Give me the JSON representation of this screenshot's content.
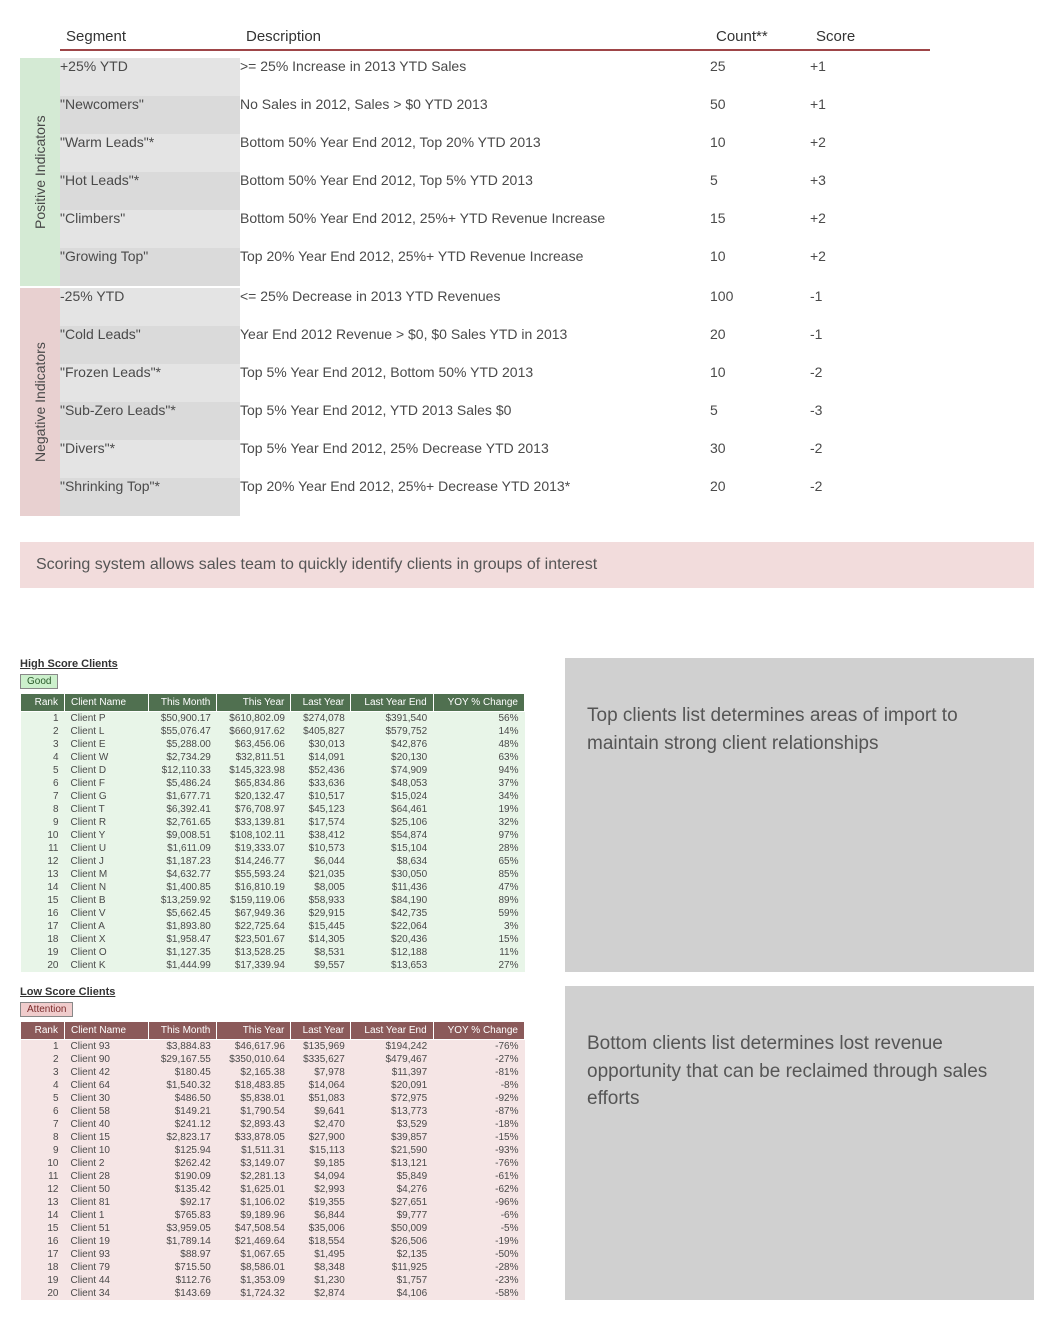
{
  "headers": {
    "segment": "Segment",
    "description": "Description",
    "count": "Count**",
    "score": "Score"
  },
  "side_labels": {
    "positive": "Positive Indicators",
    "negative": "Negative Indicators"
  },
  "positive_rows": [
    {
      "segment": "+25% YTD",
      "description": ">= 25% Increase in 2013 YTD Sales",
      "count": "25",
      "score": "+1"
    },
    {
      "segment": "\"Newcomers\"",
      "description": "No Sales in 2012, Sales > $0 YTD 2013",
      "count": "50",
      "score": "+1"
    },
    {
      "segment": "\"Warm Leads\"*",
      "description": "Bottom 50% Year End 2012, Top 20% YTD 2013",
      "count": "10",
      "score": "+2"
    },
    {
      "segment": "\"Hot Leads\"*",
      "description": "Bottom 50% Year End 2012, Top 5% YTD 2013",
      "count": "5",
      "score": "+3"
    },
    {
      "segment": "\"Climbers\"",
      "description": "Bottom 50% Year End 2012, 25%+ YTD Revenue Increase",
      "count": "15",
      "score": "+2"
    },
    {
      "segment": "\"Growing Top\"",
      "description": "Top 20% Year End 2012, 25%+ YTD Revenue Increase",
      "count": "10",
      "score": "+2"
    }
  ],
  "negative_rows": [
    {
      "segment": "-25% YTD",
      "description": "<= 25% Decrease in 2013 YTD Revenues",
      "count": "100",
      "score": "-1"
    },
    {
      "segment": "\"Cold Leads\"",
      "description": "Year End 2012 Revenue > $0, $0 Sales YTD in 2013",
      "count": "20",
      "score": "-1"
    },
    {
      "segment": "\"Frozen Leads\"*",
      "description": "Top 5% Year End 2012, Bottom 50% YTD 2013",
      "count": "10",
      "score": "-2"
    },
    {
      "segment": "\"Sub-Zero Leads\"*",
      "description": "Top 5% Year End 2012, YTD 2013 Sales $0",
      "count": "5",
      "score": "-3"
    },
    {
      "segment": "\"Divers\"*",
      "description": "Top 5% Year End 2012, 25% Decrease YTD 2013",
      "count": "30",
      "score": "-2"
    },
    {
      "segment": "\"Shrinking Top\"*",
      "description": "Top 20% Year End 2012, 25%+ Decrease YTD 2013*",
      "count": "20",
      "score": "-2"
    }
  ],
  "caption_main": "Scoring system allows sales team to quickly identify clients in groups of interest",
  "high_clients": {
    "title": "High Score Clients",
    "tag": "Good",
    "columns": [
      "Rank",
      "Client Name",
      "This Month",
      "This Year",
      "Last Year",
      "Last Year End",
      "YOY % Change"
    ],
    "rows": [
      [
        "1",
        "Client P",
        "$50,900.17",
        "$610,802.09",
        "$274,078",
        "$391,540",
        "56%"
      ],
      [
        "2",
        "Client L",
        "$55,076.47",
        "$660,917.62",
        "$405,827",
        "$579,752",
        "14%"
      ],
      [
        "3",
        "Client E",
        "$5,288.00",
        "$63,456.06",
        "$30,013",
        "$42,876",
        "48%"
      ],
      [
        "4",
        "Client W",
        "$2,734.29",
        "$32,811.51",
        "$14,091",
        "$20,130",
        "63%"
      ],
      [
        "5",
        "Client D",
        "$12,110.33",
        "$145,323.98",
        "$52,436",
        "$74,909",
        "94%"
      ],
      [
        "6",
        "Client F",
        "$5,486.24",
        "$65,834.86",
        "$33,636",
        "$48,053",
        "37%"
      ],
      [
        "7",
        "Client G",
        "$1,677.71",
        "$20,132.47",
        "$10,517",
        "$15,024",
        "34%"
      ],
      [
        "8",
        "Client T",
        "$6,392.41",
        "$76,708.97",
        "$45,123",
        "$64,461",
        "19%"
      ],
      [
        "9",
        "Client R",
        "$2,761.65",
        "$33,139.81",
        "$17,574",
        "$25,106",
        "32%"
      ],
      [
        "10",
        "Client Y",
        "$9,008.51",
        "$108,102.11",
        "$38,412",
        "$54,874",
        "97%"
      ],
      [
        "11",
        "Client U",
        "$1,611.09",
        "$19,333.07",
        "$10,573",
        "$15,104",
        "28%"
      ],
      [
        "12",
        "Client J",
        "$1,187.23",
        "$14,246.77",
        "$6,044",
        "$8,634",
        "65%"
      ],
      [
        "13",
        "Client M",
        "$4,632.77",
        "$55,593.24",
        "$21,035",
        "$30,050",
        "85%"
      ],
      [
        "14",
        "Client N",
        "$1,400.85",
        "$16,810.19",
        "$8,005",
        "$11,436",
        "47%"
      ],
      [
        "15",
        "Client B",
        "$13,259.92",
        "$159,119.06",
        "$58,933",
        "$84,190",
        "89%"
      ],
      [
        "16",
        "Client V",
        "$5,662.45",
        "$67,949.36",
        "$29,915",
        "$42,735",
        "59%"
      ],
      [
        "17",
        "Client A",
        "$1,893.80",
        "$22,725.64",
        "$15,445",
        "$22,064",
        "3%"
      ],
      [
        "18",
        "Client X",
        "$1,958.47",
        "$23,501.67",
        "$14,305",
        "$20,436",
        "15%"
      ],
      [
        "19",
        "Client O",
        "$1,127.35",
        "$13,528.25",
        "$8,531",
        "$12,188",
        "11%"
      ],
      [
        "20",
        "Client K",
        "$1,444.99",
        "$17,339.94",
        "$9,557",
        "$13,653",
        "27%"
      ]
    ],
    "caption": "Top clients list determines areas of import to maintain strong client relationships"
  },
  "low_clients": {
    "title": "Low Score Clients",
    "tag": "Attention",
    "columns": [
      "Rank",
      "Client Name",
      "This Month",
      "This Year",
      "Last Year",
      "Last Year End",
      "YOY % Change"
    ],
    "rows": [
      [
        "1",
        "Client 93",
        "$3,884.83",
        "$46,617.96",
        "$135,969",
        "$194,242",
        "-76%"
      ],
      [
        "2",
        "Client 90",
        "$29,167.55",
        "$350,010.64",
        "$335,627",
        "$479,467",
        "-27%"
      ],
      [
        "3",
        "Client 42",
        "$180.45",
        "$2,165.38",
        "$7,978",
        "$11,397",
        "-81%"
      ],
      [
        "4",
        "Client 64",
        "$1,540.32",
        "$18,483.85",
        "$14,064",
        "$20,091",
        "-8%"
      ],
      [
        "5",
        "Client 30",
        "$486.50",
        "$5,838.01",
        "$51,083",
        "$72,975",
        "-92%"
      ],
      [
        "6",
        "Client 58",
        "$149.21",
        "$1,790.54",
        "$9,641",
        "$13,773",
        "-87%"
      ],
      [
        "7",
        "Client 40",
        "$241.12",
        "$2,893.43",
        "$2,470",
        "$3,529",
        "-18%"
      ],
      [
        "8",
        "Client 15",
        "$2,823.17",
        "$33,878.05",
        "$27,900",
        "$39,857",
        "-15%"
      ],
      [
        "9",
        "Client 10",
        "$125.94",
        "$1,511.31",
        "$15,113",
        "$21,590",
        "-93%"
      ],
      [
        "10",
        "Client 2",
        "$262.42",
        "$3,149.07",
        "$9,185",
        "$13,121",
        "-76%"
      ],
      [
        "11",
        "Client 28",
        "$190.09",
        "$2,281.13",
        "$4,094",
        "$5,849",
        "-61%"
      ],
      [
        "12",
        "Client 50",
        "$135.42",
        "$1,625.01",
        "$2,993",
        "$4,276",
        "-62%"
      ],
      [
        "13",
        "Client 81",
        "$92.17",
        "$1,106.02",
        "$19,355",
        "$27,651",
        "-96%"
      ],
      [
        "14",
        "Client 1",
        "$765.83",
        "$9,189.96",
        "$6,844",
        "$9,777",
        "-6%"
      ],
      [
        "15",
        "Client 51",
        "$3,959.05",
        "$47,508.54",
        "$35,006",
        "$50,009",
        "-5%"
      ],
      [
        "16",
        "Client 19",
        "$1,789.14",
        "$21,469.64",
        "$18,554",
        "$26,506",
        "-19%"
      ],
      [
        "17",
        "Client 93",
        "$88.97",
        "$1,067.65",
        "$1,495",
        "$2,135",
        "-50%"
      ],
      [
        "18",
        "Client 79",
        "$715.50",
        "$8,586.01",
        "$8,348",
        "$11,925",
        "-28%"
      ],
      [
        "19",
        "Client 44",
        "$112.76",
        "$1,353.09",
        "$1,230",
        "$1,757",
        "-23%"
      ],
      [
        "20",
        "Client 34",
        "$143.69",
        "$1,724.32",
        "$2,874",
        "$4,106",
        "-58%"
      ]
    ],
    "caption": "Bottom clients list determines lost revenue opportunity that can be reclaimed through sales efforts"
  }
}
